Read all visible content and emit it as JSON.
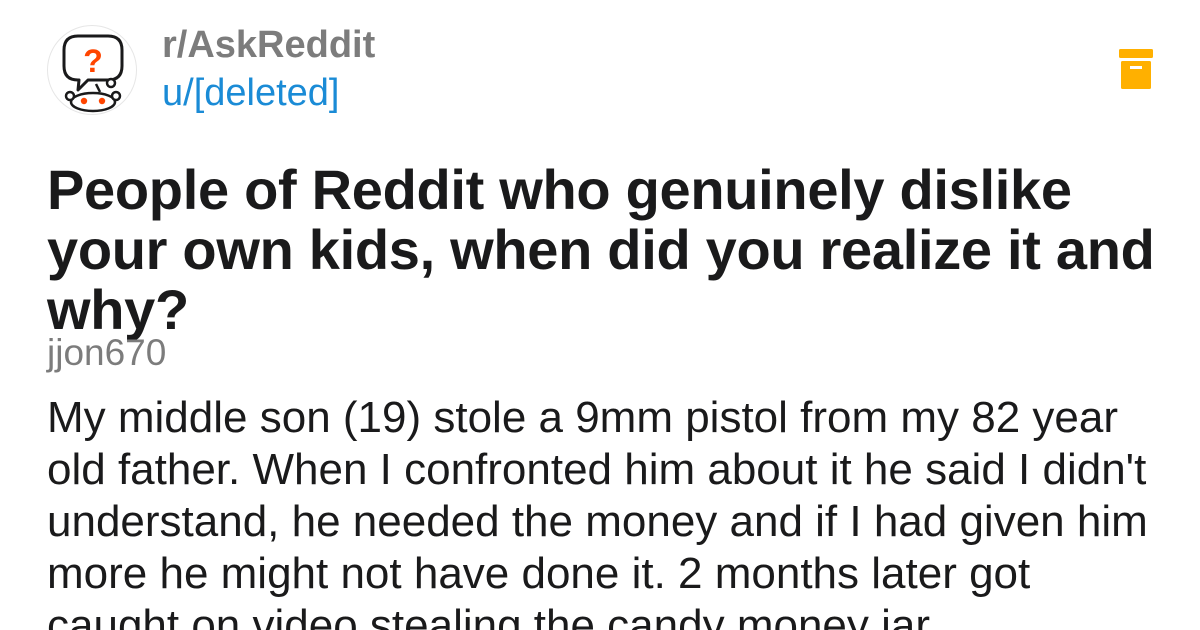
{
  "post": {
    "subreddit": "r/AskReddit",
    "author": "u/[deleted]",
    "title": "People of Reddit who genuinely dislike your own kids, when did you realize it and why?"
  },
  "comment": {
    "author": "jjon670",
    "body": "My middle son (19) stole a 9mm pistol from my 82 year old father. When I confronted him about it he said I didn't understand, he needed the money and if I had given him more he might not have done it. 2 months later got caught on video stealing the candy money jar"
  },
  "icons": {
    "avatar": "askreddit-snoo-question-icon",
    "archive": "archive-box-icon"
  },
  "colors": {
    "subreddit_text": "#7c7c7c",
    "username_link": "#1a8bd6",
    "archive_icon": "#ffb000",
    "title_text": "#1a1a1b",
    "avatar_question_mark": "#ff4500"
  }
}
